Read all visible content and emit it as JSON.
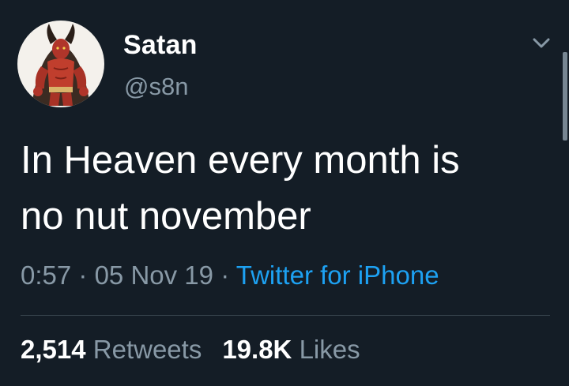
{
  "tweet": {
    "author": {
      "display_name": "Satan",
      "handle": "@s8n",
      "avatar_icon": "devil-avatar"
    },
    "text_line1": "In Heaven every month is",
    "text_line2": "no nut november",
    "time": "0:57",
    "separator": "·",
    "date": "05 Nov 19",
    "source": "Twitter for iPhone",
    "retweets_count": "2,514",
    "retweets_label": "Retweets",
    "likes_count": "19.8K",
    "likes_label": "Likes"
  },
  "colors": {
    "background": "#141d26",
    "secondary_text": "#8899a6",
    "link": "#1da1f2",
    "divider": "#38444d"
  }
}
